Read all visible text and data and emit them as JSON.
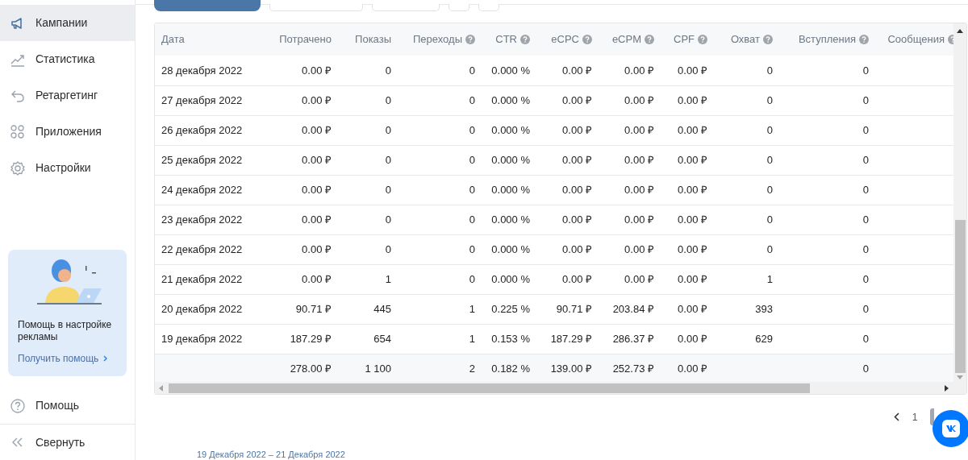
{
  "sidebar": {
    "items": [
      {
        "label": "Кампании",
        "selected": true
      },
      {
        "label": "Статистика",
        "selected": false
      },
      {
        "label": "Ретаргетинг",
        "selected": false
      },
      {
        "label": "Приложения",
        "selected": false
      },
      {
        "label": "Настройки",
        "selected": false
      }
    ],
    "help_card": {
      "text": "Помощь в настройке рекламы",
      "link": "Получить помощь"
    },
    "footer": [
      {
        "label": "Помощь"
      },
      {
        "label": "Свернуть"
      }
    ]
  },
  "table": {
    "columns": [
      {
        "label": "Дата",
        "help": false
      },
      {
        "label": "Потрачено",
        "help": false
      },
      {
        "label": "Показы",
        "help": false
      },
      {
        "label": "Переходы",
        "help": true
      },
      {
        "label": "CTR",
        "help": true
      },
      {
        "label": "eCPC",
        "help": true
      },
      {
        "label": "eCPM",
        "help": true
      },
      {
        "label": "CPF",
        "help": true
      },
      {
        "label": "Охват",
        "help": true
      },
      {
        "label": "Вступления",
        "help": true
      },
      {
        "label": "Сообщения",
        "help": true
      }
    ],
    "rows": [
      [
        "28 декабря 2022",
        "0.00 ₽",
        "0",
        "0",
        "0.000 %",
        "0.00 ₽",
        "0.00 ₽",
        "0.00 ₽",
        "0",
        "0"
      ],
      [
        "27 декабря 2022",
        "0.00 ₽",
        "0",
        "0",
        "0.000 %",
        "0.00 ₽",
        "0.00 ₽",
        "0.00 ₽",
        "0",
        "0"
      ],
      [
        "26 декабря 2022",
        "0.00 ₽",
        "0",
        "0",
        "0.000 %",
        "0.00 ₽",
        "0.00 ₽",
        "0.00 ₽",
        "0",
        "0"
      ],
      [
        "25 декабря 2022",
        "0.00 ₽",
        "0",
        "0",
        "0.000 %",
        "0.00 ₽",
        "0.00 ₽",
        "0.00 ₽",
        "0",
        "0"
      ],
      [
        "24 декабря 2022",
        "0.00 ₽",
        "0",
        "0",
        "0.000 %",
        "0.00 ₽",
        "0.00 ₽",
        "0.00 ₽",
        "0",
        "0"
      ],
      [
        "23 декабря 2022",
        "0.00 ₽",
        "0",
        "0",
        "0.000 %",
        "0.00 ₽",
        "0.00 ₽",
        "0.00 ₽",
        "0",
        "0"
      ],
      [
        "22 декабря 2022",
        "0.00 ₽",
        "0",
        "0",
        "0.000 %",
        "0.00 ₽",
        "0.00 ₽",
        "0.00 ₽",
        "0",
        "0"
      ],
      [
        "21 декабря 2022",
        "0.00 ₽",
        "1",
        "0",
        "0.000 %",
        "0.00 ₽",
        "0.00 ₽",
        "0.00 ₽",
        "1",
        "0"
      ],
      [
        "20 декабря 2022",
        "90.71 ₽",
        "445",
        "1",
        "0.225 %",
        "90.71 ₽",
        "203.84 ₽",
        "0.00 ₽",
        "393",
        "0"
      ],
      [
        "19 декабря 2022",
        "187.29 ₽",
        "654",
        "1",
        "0.153 %",
        "187.29 ₽",
        "286.37 ₽",
        "0.00 ₽",
        "629",
        "0"
      ]
    ],
    "total": {
      "spent": "278.00 ₽",
      "impressions": "1 100",
      "clicks": "2",
      "ctr": "0.182 %",
      "ecpc": "139.00 ₽",
      "ecpm": "252.73 ₽",
      "cpf": "0.00 ₽",
      "joins": "0"
    }
  },
  "pagination": [
    {
      "label": "1",
      "selected": false
    },
    {
      "selected": true
    }
  ],
  "date_range": "19 Декабря 2022 – 21 Декабря 2022"
}
